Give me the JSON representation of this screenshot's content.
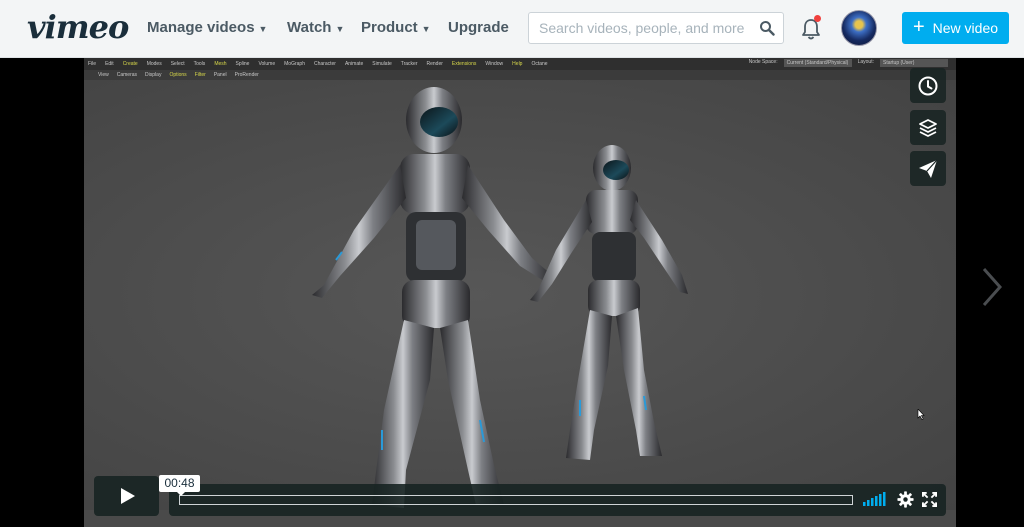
{
  "header": {
    "logo": "vimeo",
    "nav": [
      {
        "label": "Manage videos",
        "has_dropdown": true
      },
      {
        "label": "Watch",
        "has_dropdown": true
      },
      {
        "label": "Product",
        "has_dropdown": true
      },
      {
        "label": "Upgrade",
        "has_dropdown": false
      }
    ],
    "search_placeholder": "Search videos, people, and more",
    "notification_dot": true,
    "new_video_label": "New video"
  },
  "player": {
    "current_time": "00:48",
    "side_actions": [
      {
        "name": "watch-later",
        "icon": "clock-icon"
      },
      {
        "name": "collections",
        "icon": "layers-icon"
      },
      {
        "name": "share",
        "icon": "paper-plane-icon"
      }
    ],
    "app_menu": [
      "File",
      "Edit",
      "Create",
      "Modes",
      "Select",
      "Tools",
      "Mesh",
      "Spline",
      "Volume",
      "MoGraph",
      "Character",
      "Animate",
      "Simulate",
      "Tracker",
      "Render",
      "Extensions",
      "Window",
      "Help",
      "Octane"
    ],
    "app_toolbar": [
      "View",
      "Cameras",
      "Display",
      "Options",
      "Filter",
      "Panel",
      "ProRender"
    ],
    "node_space_label": "Node Space:",
    "node_space_value": "Current (Standard/Physical)",
    "layout_label": "Layout:",
    "layout_value": "Startup (User)"
  },
  "colors": {
    "brand_dark": "#1a2e3b",
    "accent": "#00adef",
    "notification": "#f0403d",
    "controls_bg": "#172322"
  }
}
